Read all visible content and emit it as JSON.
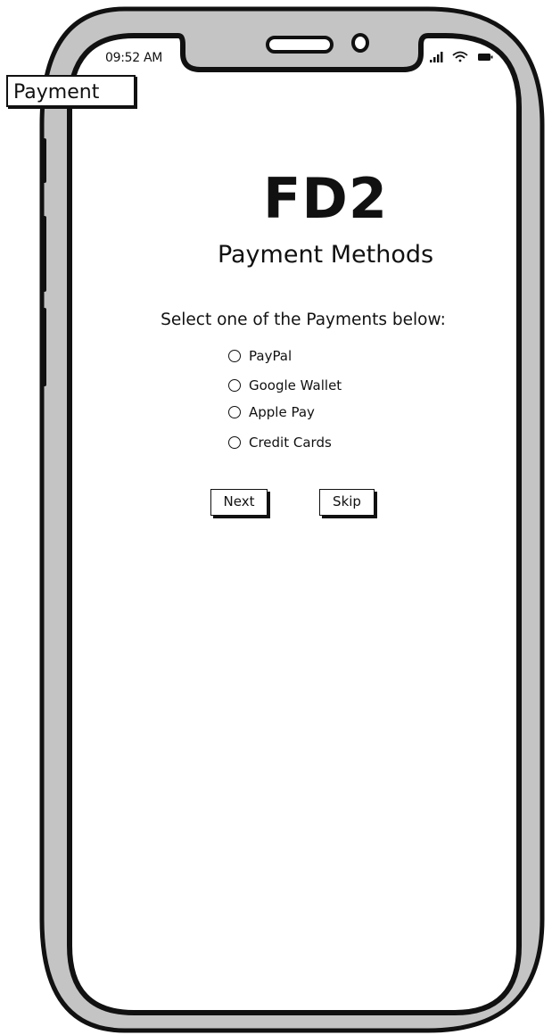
{
  "status_bar": {
    "time": "09:52 AM",
    "icons": [
      "signal-icon",
      "wifi-icon",
      "battery-icon"
    ]
  },
  "screen_label": "Payment",
  "brand": "FD2",
  "page_title": "Payment Methods",
  "instruction": "Select one of the Payments below:",
  "payment_options": [
    {
      "label": "PayPal",
      "selected": false
    },
    {
      "label": "Google Wallet",
      "selected": false
    },
    {
      "label": "Apple Pay",
      "selected": false
    },
    {
      "label": "Credit Cards",
      "selected": false
    }
  ],
  "buttons": {
    "next": "Next",
    "skip": "Skip"
  },
  "colors": {
    "frame_fill": "#c4c4c4",
    "ink": "#111111",
    "screen": "#ffffff"
  }
}
